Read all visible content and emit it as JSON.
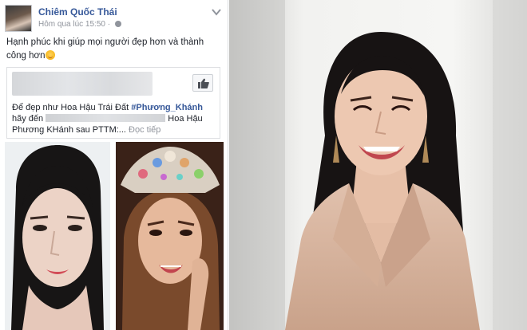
{
  "post": {
    "author": "Chiêm Quốc Thái",
    "timestamp": "Hôm qua lúc 15:50 · ",
    "status": "Hạnh phúc khi giúp mọi người đẹp hơn và thành công hơn",
    "shared": {
      "text_before": "Để đẹp như Hoa Hậu Trái Đất ",
      "hashtag": "#Phương_Khánh",
      "text_mid": " hãy đến ",
      "text_after": " Hoa Hậu Phương KHánh sau PTTM:... ",
      "read_more": "Đọc tiếp"
    }
  },
  "icons": {
    "globe": "globe-icon",
    "chevron": "chevron-down-icon",
    "like": "thumbs-up-icon",
    "emoji": "smiling-face-icon"
  },
  "colors": {
    "link_blue": "#365899",
    "meta_gray": "#90949c",
    "text": "#1d2129",
    "coat": "#d7b49d"
  }
}
